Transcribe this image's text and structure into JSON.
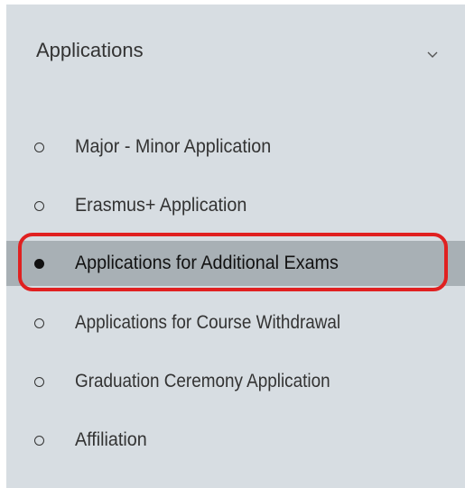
{
  "section": {
    "title": "Applications",
    "toggle_icon": "chevron-down-icon"
  },
  "menu": {
    "items": [
      {
        "label": "Major - Minor Application",
        "active": false,
        "icon": "circle-outline-icon"
      },
      {
        "label": "Erasmus+ Application",
        "active": false,
        "icon": "circle-outline-icon"
      },
      {
        "label": "Applications for Additional Exams",
        "active": true,
        "icon": "circle-filled-icon"
      },
      {
        "label": "Applications for Course Withdrawal",
        "active": false,
        "icon": "circle-outline-icon"
      },
      {
        "label": "Graduation Ceremony Application",
        "active": false,
        "icon": "circle-outline-icon"
      },
      {
        "label": "Affiliation",
        "active": false,
        "icon": "circle-outline-icon"
      }
    ]
  },
  "colors": {
    "panel_background": "#d7dde2",
    "active_background": "#a8b0b5",
    "highlight_outline": "#e02020"
  }
}
